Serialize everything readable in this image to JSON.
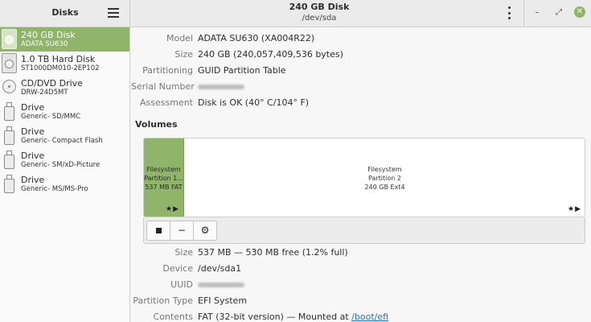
{
  "sidebar": {
    "title": "Disks",
    "disks": [
      {
        "name": "240 GB Disk",
        "sub": "ADATA SU630",
        "icon": "ssd-icon",
        "selected": true
      },
      {
        "name": "1.0 TB Hard Disk",
        "sub": "ST1000DM010-2EP102",
        "icon": "hard-disk-icon",
        "selected": false
      },
      {
        "name": "CD/DVD Drive",
        "sub": "DRW-24D5MT",
        "icon": "optical-drive-icon",
        "selected": false
      },
      {
        "name": "Drive",
        "sub": "Generic- SD/MMC",
        "icon": "usb-drive-icon",
        "selected": false
      },
      {
        "name": "Drive",
        "sub": "Generic- Compact Flash",
        "icon": "usb-drive-icon",
        "selected": false
      },
      {
        "name": "Drive",
        "sub": "Generic- SM/xD-Picture",
        "icon": "usb-drive-icon",
        "selected": false
      },
      {
        "name": "Drive",
        "sub": "Generic- MS/MS-Pro",
        "icon": "usb-drive-icon",
        "selected": false
      }
    ]
  },
  "header": {
    "title": "240 GB Disk",
    "subtitle": "/dev/sda",
    "window_controls": {
      "minimize": "–",
      "maximize": "⤢",
      "close": "✕"
    }
  },
  "disk_info": {
    "model_label": "Model",
    "model": "ADATA SU630 (XA004R22)",
    "size_label": "Size",
    "size": "240 GB (240,057,409,536 bytes)",
    "partitioning_label": "Partitioning",
    "partitioning": "GUID Partition Table",
    "serial_label": "Serial Number",
    "assessment_label": "Assessment",
    "assessment": "Disk is OK (40° C/104° F)"
  },
  "volumes": {
    "title": "Volumes",
    "partitions": [
      {
        "line1": "Filesystem",
        "line2": "Partition 1...",
        "line3": "537 MB FAT",
        "badge": "★▶"
      },
      {
        "line1": "Filesystem",
        "line2": "Partition 2",
        "line3": "240 GB Ext4",
        "badge": "★▶"
      }
    ],
    "toolbar": {
      "stop": "stop",
      "remove": "−",
      "options": "⚙"
    }
  },
  "volume_info": {
    "size_label": "Size",
    "size": "537 MB — 530 MB free (1.2% full)",
    "device_label": "Device",
    "device": "/dev/sda1",
    "uuid_label": "UUID",
    "partition_type_label": "Partition Type",
    "partition_type": "EFI System",
    "contents_label": "Contents",
    "contents_prefix": "FAT (32-bit version) — Mounted at ",
    "mount_point": "/boot/efi"
  },
  "colors": {
    "accent": "#8fb46a",
    "link": "#2a6fb8"
  }
}
